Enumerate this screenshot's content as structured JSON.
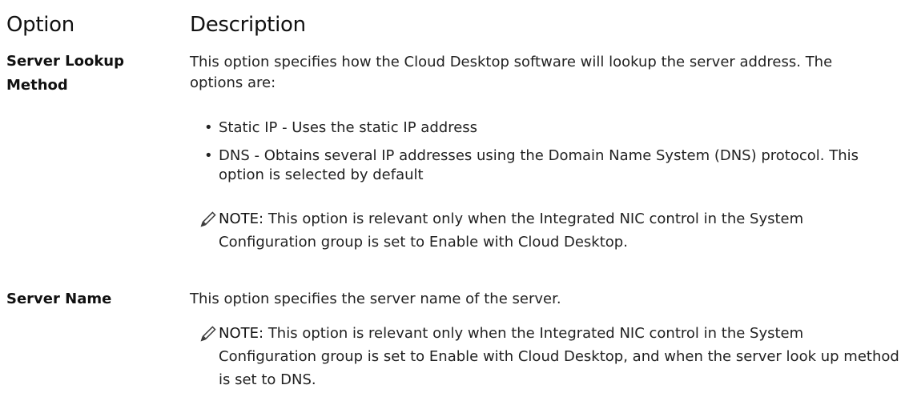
{
  "table": {
    "header_option": "Option",
    "header_description": "Description"
  },
  "rows": [
    {
      "option": "Server Lookup Method",
      "description": "This option specifies how the Cloud Desktop software will lookup the server address. The options are:",
      "bullets": [
        "Static IP - Uses the static IP address",
        "DNS - Obtains several IP addresses using the Domain Name System (DNS) protocol. This option is selected by default"
      ],
      "note_label": "NOTE:",
      "note_text": "This option is relevant only when the Integrated NIC control in the System Configuration group is set to Enable with Cloud Desktop."
    },
    {
      "option": "Server Name",
      "description": "This option specifies the server name of the server.",
      "note_label": "NOTE:",
      "note_text": "This option is relevant only when the Integrated NIC control in the System Configuration group is set to Enable with Cloud Desktop, and when the server look up method is set to DNS."
    }
  ],
  "icons": {
    "note": "pencil-note-icon"
  },
  "colors": {
    "text": "#222222",
    "heading": "#111111"
  }
}
